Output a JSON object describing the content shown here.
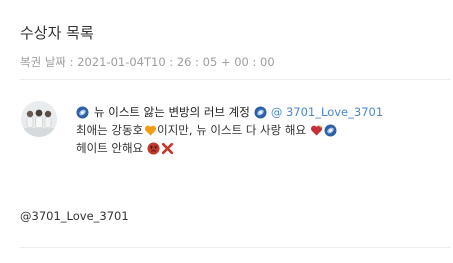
{
  "page": {
    "title": "수상자 목록",
    "restored_date": "복권 날짜 : 2021-01-04T10 : 26 : 05 + 00 : 00"
  },
  "winner": {
    "display_name": "뉴 이스트 앓는 변방의 러브 계정",
    "handle": "@ 3701_Love_3701",
    "line2_before_icon": "최애는 강동호",
    "line2_after_icon": "이지만, 뉴 이스트 다 사랑 해요",
    "line3_text": "헤이트 안해요"
  },
  "footer": {
    "handle": "@3701_Love_3701"
  },
  "icons": {
    "badge": "blue-sapphire-badge-icon",
    "heart_orange": "orange-heart-icon",
    "heart_red": "sparkling-red-heart-icon",
    "angry": "angry-face-icon",
    "cross": "red-cross-mark-icon"
  },
  "colors": {
    "link": "#4a86c6",
    "badge": "#2f5fa5",
    "orange_heart": "#f39c12",
    "red_heart": "#c62f3b",
    "cross": "#c0392b"
  }
}
